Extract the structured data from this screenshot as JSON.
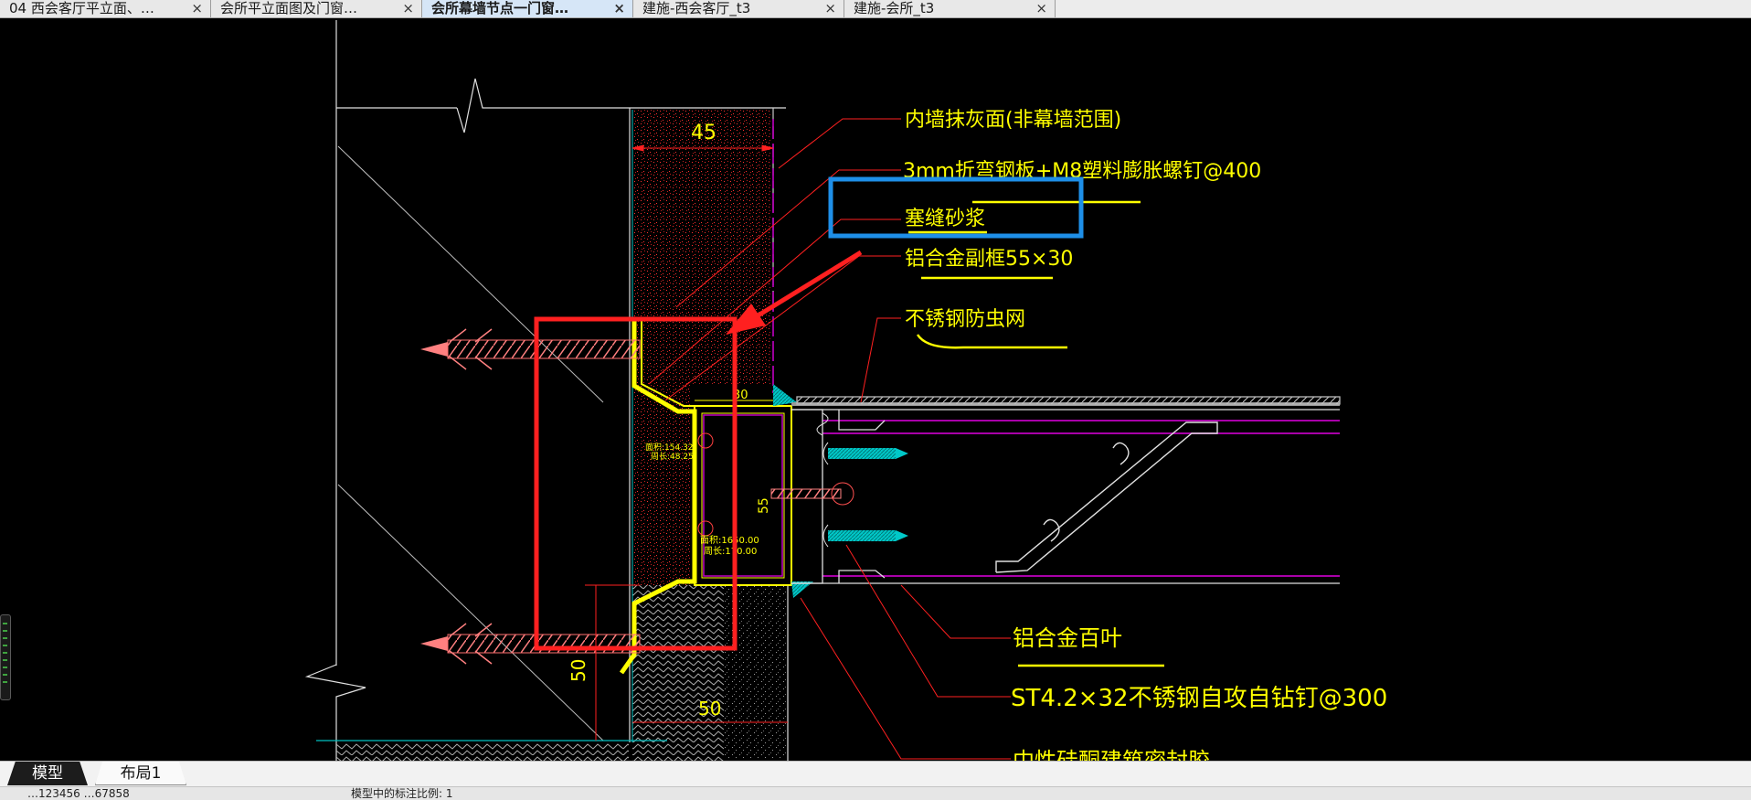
{
  "doc_tabs": [
    {
      "label": "04 西会客厅平立面、…",
      "active": false
    },
    {
      "label": "会所平立面图及门窗…",
      "active": false
    },
    {
      "label": "会所幕墙节点一门窗…",
      "active": true
    },
    {
      "label": "建施-西会客厅_t3",
      "active": false
    },
    {
      "label": "建施-会所_t3",
      "active": false
    }
  ],
  "tab_close_glyph": "×",
  "layout_tabs": {
    "model": "模型",
    "layout1": "布局1"
  },
  "status": {
    "coords": "…123456  …67858",
    "message": "模型中的标注比例: 1"
  },
  "drawing": {
    "dim_top": "45",
    "dim_small": "30",
    "dim_side_mid": "55",
    "dim_bottom_vertical": "50",
    "dim_bottom": "50",
    "callouts": {
      "c1": "内墙抹灰面(非幕墙范围)",
      "c2": "3mm折弯钢板+M8塑料膨胀螺钉@400",
      "c3": "塞缝砂浆",
      "c4": "铝合金副框55×30",
      "c5": "不锈钢防虫网",
      "c6": "铝合金百叶",
      "c7": "ST4.2×32不锈钢自攻自钻钉@300",
      "c8": "中性硅酮建筑密封胶"
    },
    "small_text": {
      "t1a": "面积:154.32",
      "t1b": "周长:48.25",
      "t2a": "面积:1650.00",
      "t2b": "周长:170.00"
    }
  },
  "colors": {
    "cad_yellow": "#ffff00",
    "cad_red": "#ff2020",
    "cad_magenta": "#c000c0",
    "cad_cyan": "#00e5e5",
    "annot_red": "#ff2020",
    "annot_blue": "#1e8fe8"
  }
}
